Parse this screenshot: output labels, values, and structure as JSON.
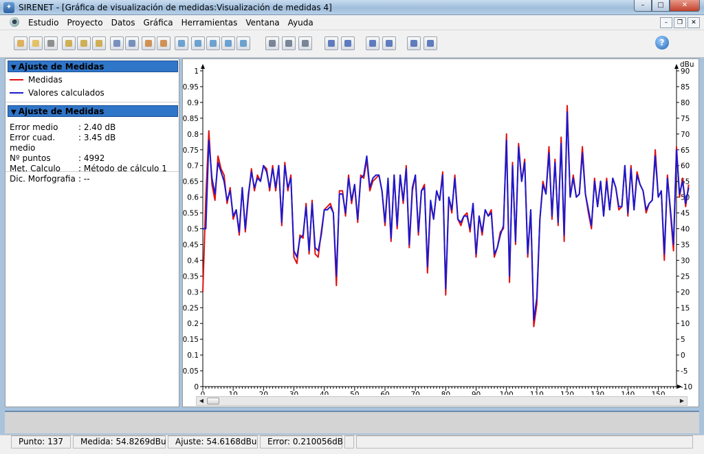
{
  "window": {
    "app_name": "SIRENET",
    "title": "SIRENET - [Gráfica de visualización de medidas:Visualización de medidas 4]",
    "buttons": {
      "minimize": "–",
      "maximize": "□",
      "close": "✕"
    }
  },
  "menu": {
    "items": [
      "Estudio",
      "Proyecto",
      "Datos",
      "Gráfica",
      "Herramientas",
      "Ventana",
      "Ayuda"
    ],
    "mdi": {
      "minimize": "–",
      "restore": "❐",
      "close": "✕"
    }
  },
  "toolbar": {
    "icons": [
      "study-icon",
      "open-folder-icon",
      "stop-icon",
      "calc-x-icon",
      "calc-x2-icon",
      "calc-clock-icon",
      "wrench-icon",
      "import-icon",
      "save-icon",
      "save-all-icon",
      "export-icon",
      "wsd-icon",
      "filter-icon",
      "copy-icon",
      "database-icon",
      "print-icon",
      "print-setup-icon",
      "print-preview-icon",
      "zoom-x-icon",
      "zoom-x2-icon",
      "zoom-y-icon",
      "zoom-y2-icon",
      "grid-icon",
      "grid2-icon",
      "help-icon"
    ],
    "help_label": "?"
  },
  "legend_panel": {
    "header": "Ajuste de Medidas",
    "entries": [
      {
        "label": "Medidas",
        "color": "#e01010"
      },
      {
        "label": "Valores calculados",
        "color": "#1a1ad0"
      }
    ]
  },
  "stats_panel": {
    "header": "Ajuste de Medidas",
    "rows": [
      {
        "label": "Error medio",
        "value": ": 2.40 dB"
      },
      {
        "label": "Error cuad. medio",
        "value": ": 3.45 dB"
      },
      {
        "label": "Nº puntos",
        "value": ": 4992"
      },
      {
        "label": "Met. Calculo",
        "value": ": Método de cálculo 1"
      },
      {
        "label": "Dic. Morfografia",
        "value": ": --"
      }
    ]
  },
  "chart_data": {
    "type": "line",
    "x_ticks": [
      0,
      10,
      20,
      30,
      40,
      50,
      60,
      70,
      80,
      90,
      100,
      110,
      120,
      130,
      140,
      150
    ],
    "xlim": [
      0,
      156
    ],
    "left_axis": {
      "ticks": [
        "0",
        "0.05",
        "0.1",
        "0.15",
        "0.2",
        "0.25",
        "0.3",
        "0.35",
        "0.4",
        "0.45",
        "0.5",
        "0.55",
        "0.6",
        "0.65",
        "0.7",
        "0.75",
        "0.8",
        "0.85",
        "0.9",
        "0.95",
        "1"
      ],
      "ylim": [
        0,
        1
      ]
    },
    "right_axis": {
      "unit": "dBu",
      "ticks": [
        "-10",
        "-5",
        "0",
        "5",
        "10",
        "15",
        "20",
        "25",
        "30",
        "35",
        "40",
        "45",
        "50",
        "55",
        "60",
        "65",
        "70",
        "75",
        "80",
        "85",
        "90"
      ],
      "ylim": [
        -10,
        90
      ]
    },
    "series": [
      {
        "name": "Medidas",
        "color": "#e01010",
        "values": [
          20,
          50,
          71,
          54,
          49,
          63,
          59,
          57,
          48,
          53,
          43,
          46,
          38,
          53,
          39,
          50,
          59,
          52,
          57,
          55,
          60,
          59,
          52,
          60,
          52,
          60,
          41,
          61,
          52,
          57,
          31,
          29,
          38,
          37,
          48,
          32,
          49,
          32,
          31,
          39,
          46,
          47,
          48,
          45,
          22,
          52,
          52,
          44,
          57,
          48,
          54,
          42,
          57,
          56,
          62,
          52,
          55,
          56,
          57,
          52,
          41,
          55,
          36,
          57,
          40,
          57,
          48,
          60,
          34,
          52,
          57,
          38,
          52,
          54,
          26,
          48,
          43,
          52,
          49,
          58,
          19,
          50,
          45,
          57,
          43,
          41,
          44,
          45,
          39,
          48,
          31,
          44,
          38,
          46,
          44,
          46,
          31,
          34,
          39,
          40,
          70,
          23,
          61,
          35,
          67,
          55,
          62,
          31,
          46,
          9,
          16,
          43,
          55,
          51,
          66,
          43,
          62,
          41,
          69,
          36,
          79,
          50,
          57,
          50,
          51,
          66,
          51,
          45,
          40,
          56,
          47,
          55,
          44,
          56,
          46,
          56,
          53,
          46,
          47,
          60,
          44,
          60,
          46,
          58,
          54,
          52,
          45,
          48,
          49,
          65,
          50,
          52,
          30,
          57,
          45,
          33,
          66,
          50,
          56,
          47,
          54
        ]
      },
      {
        "name": "Valores calculados",
        "color": "#1a1ad0",
        "values": [
          40,
          40,
          68,
          56,
          51,
          61,
          58,
          55,
          49,
          52,
          44,
          46,
          39,
          53,
          40,
          51,
          58,
          53,
          56,
          55,
          60,
          58,
          53,
          59,
          53,
          60,
          42,
          60,
          53,
          56,
          33,
          31,
          37,
          38,
          47,
          33,
          48,
          34,
          33,
          38,
          46,
          46,
          47,
          45,
          25,
          51,
          51,
          45,
          56,
          49,
          54,
          43,
          56,
          57,
          63,
          53,
          56,
          57,
          57,
          52,
          42,
          56,
          37,
          57,
          41,
          57,
          49,
          59,
          35,
          53,
          57,
          39,
          52,
          53,
          28,
          49,
          43,
          52,
          49,
          57,
          21,
          50,
          46,
          56,
          43,
          42,
          44,
          44,
          40,
          48,
          32,
          44,
          39,
          46,
          44,
          45,
          32,
          34,
          38,
          41,
          68,
          25,
          60,
          36,
          66,
          55,
          61,
          32,
          46,
          11,
          18,
          43,
          54,
          51,
          64,
          44,
          61,
          42,
          67,
          38,
          77,
          50,
          56,
          50,
          51,
          64,
          51,
          46,
          41,
          55,
          47,
          55,
          44,
          55,
          46,
          56,
          53,
          47,
          47,
          60,
          45,
          59,
          46,
          57,
          54,
          52,
          46,
          48,
          49,
          63,
          50,
          52,
          32,
          56,
          46,
          35,
          65,
          51,
          55,
          48,
          53
        ]
      }
    ]
  },
  "status": {
    "punto": "Punto: 137",
    "medida": "Medida: 54.8269dBu",
    "ajuste": "Ajuste: 54.6168dBu",
    "error": "Error: 0.210056dB"
  }
}
